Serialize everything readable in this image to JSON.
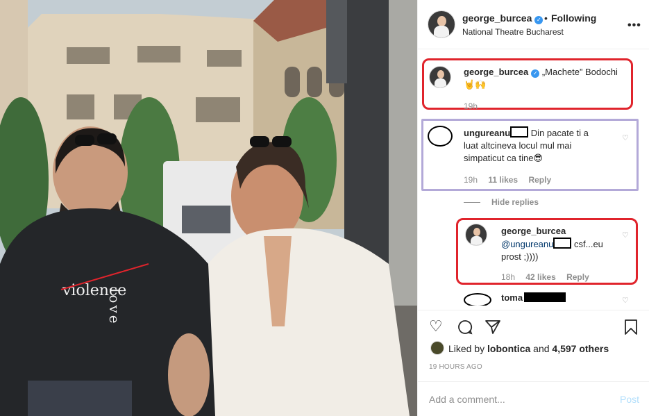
{
  "header": {
    "username": "george_burcea",
    "separator": "•",
    "follow_label": "Following",
    "location": "National Theatre Bucharest"
  },
  "photo": {
    "shirt_text_1": "violence",
    "shirt_text_2": "love"
  },
  "caption": {
    "username": "george_burcea",
    "text": "„Machete” Bodochi",
    "emoji": "🤘🙌",
    "time": "19h"
  },
  "comments": [
    {
      "username": "ungureanu",
      "text_1": "Din pacate ti a",
      "text_2": "luat altcineva locul mul mai",
      "text_3": "simpaticut ca tine😎",
      "time": "19h",
      "likes": "11 likes",
      "reply_label": "Reply"
    }
  ],
  "hide_replies_label": "Hide replies",
  "reply": {
    "username": "george_burcea",
    "mention": "@ungureanu",
    "text_1": "csf...eu",
    "text_2": "prost ;))))",
    "time": "18h",
    "likes": "42 likes",
    "reply_label": "Reply"
  },
  "partial_comment": {
    "username": "toma"
  },
  "actions": {
    "liked_by_prefix": "Liked by",
    "liked_by_user": "lobontica",
    "liked_by_and": "and",
    "liked_by_others": "4,597 others",
    "time_ago": "19 HOURS AGO"
  },
  "comment_box": {
    "placeholder": "Add a comment...",
    "post_label": "Post"
  },
  "colors": {
    "highlight_red": "#e0242c",
    "highlight_purple": "#b3a9d8",
    "link_blue": "#3897f0",
    "post_disabled": "#b2dffc"
  },
  "icons": [
    "verified-badge-icon",
    "more-options-icon",
    "heart-icon",
    "comment-icon",
    "share-icon",
    "bookmark-icon"
  ]
}
